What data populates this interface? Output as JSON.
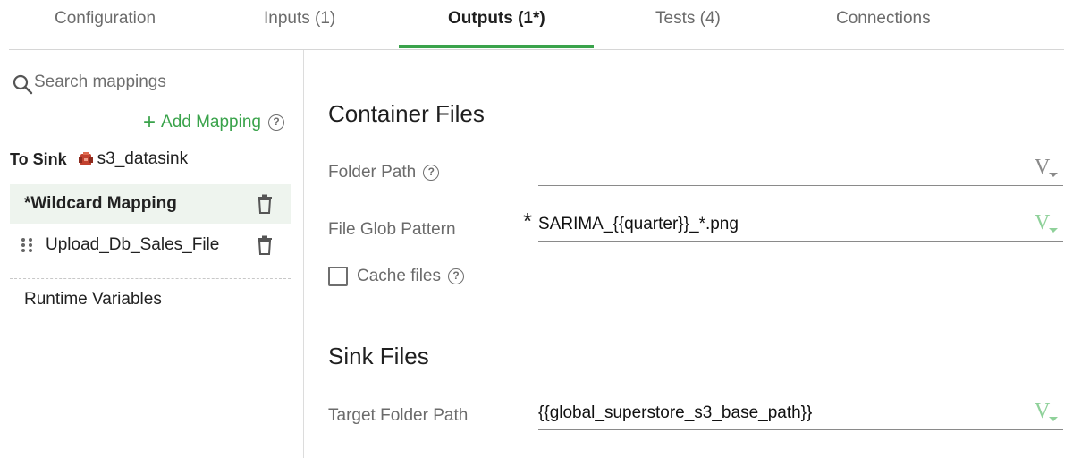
{
  "tabs": [
    {
      "label": "Configuration"
    },
    {
      "label": "Inputs (1)"
    },
    {
      "label": "Outputs (1*)"
    },
    {
      "label": "Tests (4)"
    },
    {
      "label": "Connections"
    }
  ],
  "active_tab_index": 2,
  "accent_color": "#3aa34b",
  "sidebar": {
    "search_placeholder": "Search mappings",
    "add_mapping_label": "Add Mapping",
    "to_sink_label": "To Sink",
    "sink_name": "s3_datasink",
    "mappings": [
      {
        "title": "*Wildcard Mapping",
        "selected": true
      },
      {
        "title": "Upload_Db_Sales_File",
        "selected": false
      }
    ],
    "runtime_variables_label": "Runtime Variables"
  },
  "main": {
    "container_section_title": "Container Files",
    "folder_path_label": "Folder Path",
    "folder_path_value": "",
    "file_glob_label": "File Glob Pattern",
    "file_glob_value": "SARIMA_{{quarter}}_*.png",
    "required_marker": "*",
    "cache_files_label": "Cache files",
    "cache_files_checked": false,
    "sink_section_title": "Sink Files",
    "target_folder_label": "Target Folder Path",
    "target_folder_value": "{{global_superstore_s3_base_path}}"
  }
}
